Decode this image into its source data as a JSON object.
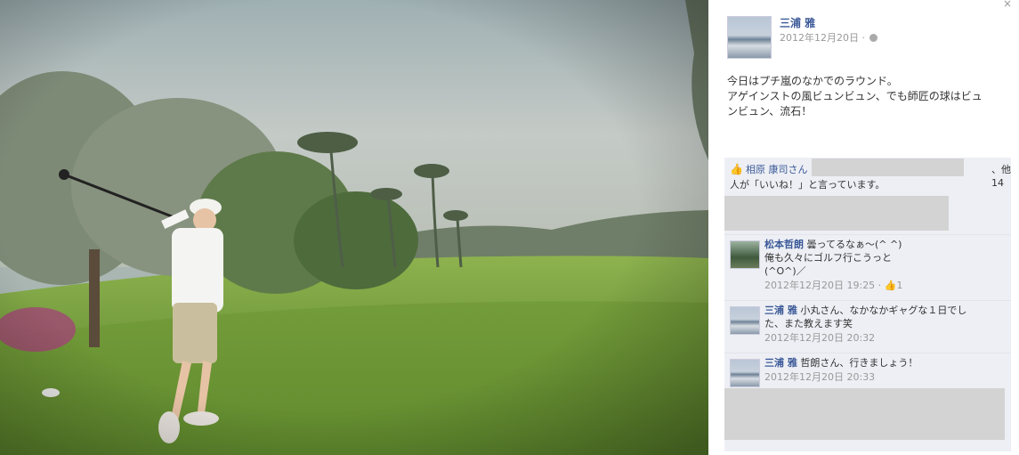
{
  "post": {
    "author": "三浦 雅",
    "date": "2012年12月20日 ·",
    "text_lines": [
      "今日はプチ嵐のなかでのラウンド。",
      "アゲインストの風ビュンビュン、でも師匠の球はビュ",
      "ンビュン、流石！"
    ]
  },
  "likes": {
    "thumb_icon": "👍",
    "name": "相原 康司さん",
    "suffix": "、他14",
    "line2": "人が「いいね！」と言っています。"
  },
  "comments": [
    {
      "name": "松本哲朗",
      "lines": [
        " 曇ってるなぁ〜(^ ^)",
        "俺も久々にゴルフ行こうっと",
        "(^O^)／"
      ],
      "time": "2012年12月20日 19:25 · ",
      "like_count": "1"
    },
    {
      "name": "三浦 雅",
      "lines": [
        " 小丸さん、なかなかギャグな１日でし",
        "た、また教えます笑"
      ],
      "time": "2012年12月20日 20:32"
    },
    {
      "name": "三浦 雅",
      "lines": [
        " 哲朗さん、行きましょう！"
      ],
      "time": "2012年12月20日 20:33"
    }
  ],
  "close_icon": "×"
}
